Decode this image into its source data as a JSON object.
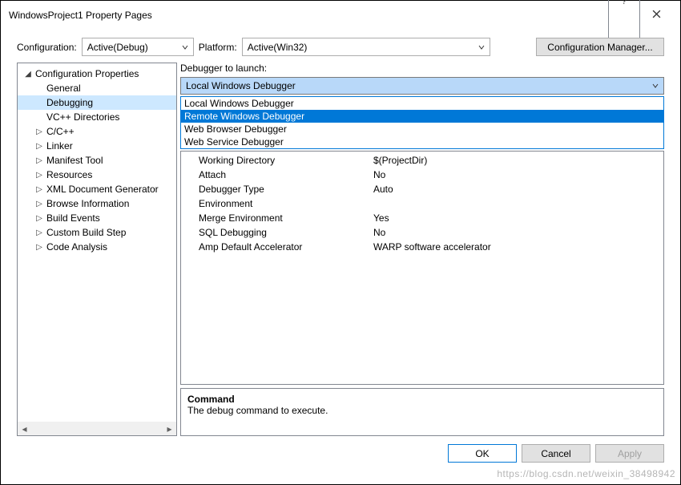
{
  "window": {
    "title": "WindowsProject1 Property Pages"
  },
  "toolbar": {
    "configuration_label": "Configuration:",
    "configuration_value": "Active(Debug)",
    "platform_label": "Platform:",
    "platform_value": "Active(Win32)",
    "config_manager": "Configuration Manager..."
  },
  "tree": {
    "root": "Configuration Properties",
    "items": [
      {
        "label": "General",
        "hasChildren": false
      },
      {
        "label": "Debugging",
        "hasChildren": false,
        "selected": true
      },
      {
        "label": "VC++ Directories",
        "hasChildren": false
      },
      {
        "label": "C/C++",
        "hasChildren": true
      },
      {
        "label": "Linker",
        "hasChildren": true
      },
      {
        "label": "Manifest Tool",
        "hasChildren": true
      },
      {
        "label": "Resources",
        "hasChildren": true
      },
      {
        "label": "XML Document Generator",
        "hasChildren": true
      },
      {
        "label": "Browse Information",
        "hasChildren": true
      },
      {
        "label": "Build Events",
        "hasChildren": true
      },
      {
        "label": "Custom Build Step",
        "hasChildren": true
      },
      {
        "label": "Code Analysis",
        "hasChildren": true
      }
    ]
  },
  "right": {
    "launch_label": "Debugger to launch:",
    "launch_value": "Local Windows Debugger",
    "options": [
      "Local Windows Debugger",
      "Remote Windows Debugger",
      "Web Browser Debugger",
      "Web Service Debugger"
    ],
    "options_selected_index": 1,
    "props": [
      {
        "k": "Working Directory",
        "v": "$(ProjectDir)"
      },
      {
        "k": "Attach",
        "v": "No"
      },
      {
        "k": "Debugger Type",
        "v": "Auto"
      },
      {
        "k": "Environment",
        "v": ""
      },
      {
        "k": "Merge Environment",
        "v": "Yes"
      },
      {
        "k": "SQL Debugging",
        "v": "No"
      },
      {
        "k": "Amp Default Accelerator",
        "v": "WARP software accelerator"
      }
    ],
    "help_heading": "Command",
    "help_text": "The debug command to execute."
  },
  "footer": {
    "ok": "OK",
    "cancel": "Cancel",
    "apply": "Apply"
  },
  "watermark": "https://blog.csdn.net/weixin_38498942"
}
